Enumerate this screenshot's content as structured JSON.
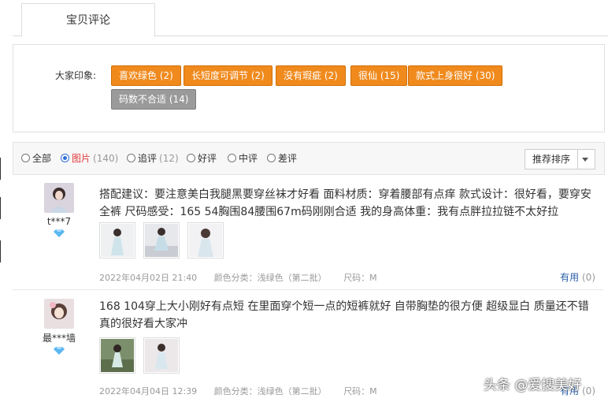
{
  "tab": {
    "label": "宝贝评论"
  },
  "impressions": {
    "label": "大家印象:",
    "tags": [
      {
        "text": "喜欢绿色 (2)",
        "style": "orange"
      },
      {
        "text": "长短度可调节 (2)",
        "style": "orange"
      },
      {
        "text": "没有瑕疵 (2)",
        "style": "orange"
      },
      {
        "text": "很仙 (15)",
        "style": "orange"
      },
      {
        "text": "款式上身很好 (30)",
        "style": "orange"
      },
      {
        "text": "码数不合适 (14)",
        "style": "gray"
      }
    ]
  },
  "filters": {
    "options": [
      {
        "label": "全部",
        "count": "",
        "selected": false
      },
      {
        "label": "图片",
        "count": "(140)",
        "selected": true
      },
      {
        "label": "追评",
        "count": "(12)",
        "selected": false
      },
      {
        "label": "好评",
        "count": "",
        "selected": false
      },
      {
        "label": "中评",
        "count": "",
        "selected": false
      },
      {
        "label": "差评",
        "count": "",
        "selected": false
      }
    ],
    "sort_label": "推荐排序"
  },
  "reviews": [
    {
      "user": "t***7",
      "text": "搭配建议：要注意美白我腿黑要穿丝袜才好看 面料材质：穿着腰部有点痒 款式设计：很好看，要穿安全裤 尺码感受：165 54胸围84腰围67m码刚刚合适 我的身高体重：我有点胖拉拉链不太好拉",
      "date": "2022年04月02日 21:40",
      "color": "颜色分类：浅绿色（第二批）",
      "size": "尺码：M",
      "useful_label": "有用",
      "useful_count": "(0)"
    },
    {
      "user": "最***墙",
      "text": "168 104穿上大小刚好有点短 在里面穿个短一点的短裤就好 自带胸垫的很方便 超级显白 质量还不错真的很好看大家冲",
      "date": "2022年04月04日 12:39",
      "color": "颜色分类：浅绿色（第二批）",
      "size": "尺码：M",
      "useful_label": "有用",
      "useful_count": "(0)"
    }
  ],
  "watermark": "头条 @爱搜美好",
  "colors": {
    "tag_orange": "#f08a1d",
    "tag_gray": "#9a9a9a",
    "selected_red": "#e4393c",
    "link_blue": "#2b5fa8"
  }
}
